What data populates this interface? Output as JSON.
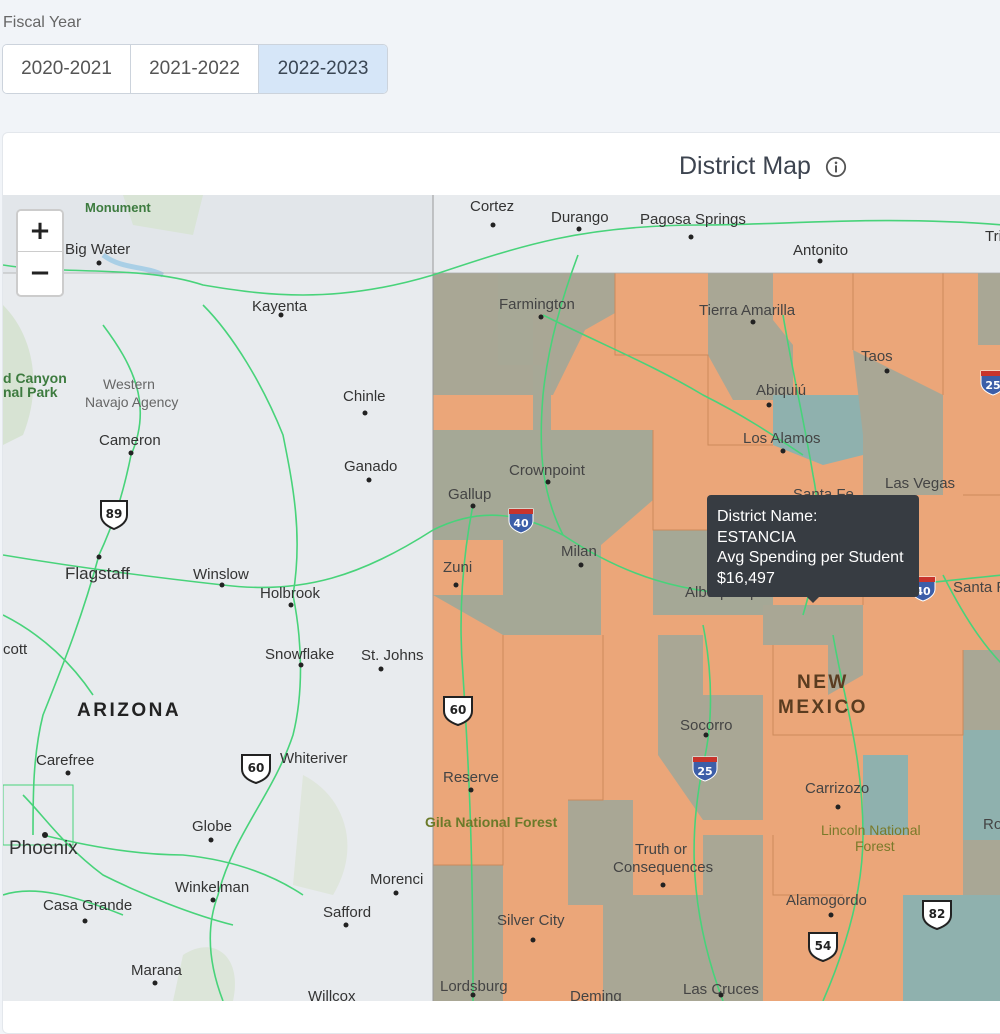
{
  "filter": {
    "label": "Fiscal Year",
    "options": [
      "2020-2021",
      "2021-2022",
      "2022-2023"
    ],
    "selected": "2022-2023"
  },
  "map_card": {
    "title": "District Map",
    "info_icon": "info-icon"
  },
  "zoom": {
    "in_label": "+",
    "out_label": "−"
  },
  "tooltip": {
    "name_label": "District Name:",
    "name_value": "ESTANCIA",
    "metric_label": "Avg Spending per Student",
    "metric_value": "$16,497"
  },
  "colors": {
    "high_spending": "#eba679",
    "mid_spending": "#a9a795",
    "low_spending": "#8fb1ae",
    "map_base": "#e8ebee",
    "roads": "#48d37a",
    "tooltip_bg": "#373c42",
    "selected_option_bg": "#d6e6f8"
  },
  "map_labels": {
    "states": [
      "ARIZONA",
      "NEW MEXICO"
    ],
    "places": [
      "Monument",
      "Cortez",
      "Durango",
      "Pagosa Springs",
      "Antonito",
      "Tri",
      "Big Water",
      "Kayenta",
      "Farmington",
      "Tierra Amarilla",
      "Taos",
      "Canyon",
      "nal Park",
      "Western",
      "Navajo Agency",
      "Chinle",
      "Abiquiú",
      "Los Alamos",
      "Cameron",
      "Ganado",
      "Crownpoint",
      "Las Vegas",
      "Santa Fe",
      "Gallup",
      "Milan",
      "Zuni",
      "Albuquerque",
      "Santa R",
      "Flagstaff",
      "Winslow",
      "Holbrook",
      "cott",
      "Snowflake",
      "St. Johns",
      "Socorro",
      "Carefree",
      "Whiteriver",
      "Reserve",
      "Carrizozo",
      "Lincoln National",
      "Forest",
      "Ro",
      "Gila National Forest",
      "Globe",
      "Phoenix",
      "Truth or",
      "Consequences",
      "Winkelman",
      "Morenci",
      "Casa Grande",
      "Safford",
      "Alamogordo",
      "Silver City",
      "Marana",
      "Willcox",
      "Lordsburg",
      "Deming",
      "Las Cruces"
    ],
    "shields": [
      "89",
      "40",
      "60",
      "60",
      "25",
      "25",
      "40",
      "54",
      "82"
    ]
  }
}
